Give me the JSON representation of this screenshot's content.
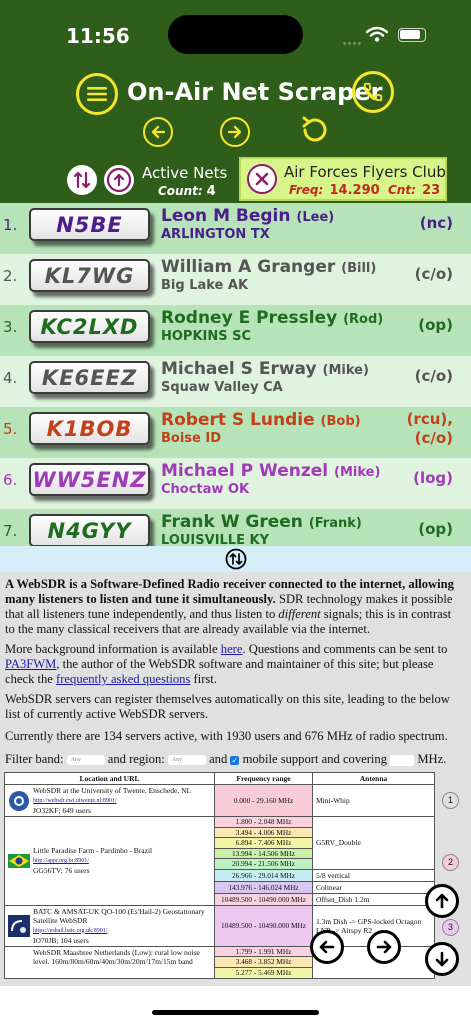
{
  "status": {
    "time": "11:56"
  },
  "header": {
    "title": "On-Air Net Scraper"
  },
  "active": {
    "label": "Active Nets",
    "count_label": "Count:",
    "count": "4"
  },
  "net": {
    "name": "Air Forces Flyers Club",
    "freq_label": "Freq:",
    "freq": "14.290",
    "cnt_label": "Cnt:",
    "cnt": "23"
  },
  "stations": [
    {
      "num": "1.",
      "call": "N5BE",
      "name": "Leon M Begin",
      "nick": "(Lee)",
      "loc": "ARLINGTON TX",
      "role": "(nc)",
      "color": "#4a1f8c",
      "bg": "#b7e3b8"
    },
    {
      "num": "2.",
      "call": "KL7WG",
      "name": "William A Granger",
      "nick": "(Bill)",
      "loc": "Big Lake AK",
      "role": "(c/o)",
      "color": "#555555",
      "bg": "#dff3df"
    },
    {
      "num": "3.",
      "call": "KC2LXD",
      "name": "Rodney E Pressley",
      "nick": "(Rod)",
      "loc": "HOPKINS SC",
      "role": "(op)",
      "color": "#1f6b1f",
      "bg": "#b7e3b8"
    },
    {
      "num": "4.",
      "call": "KE6EEZ",
      "name": "Michael S Erway",
      "nick": "(Mike)",
      "loc": "Squaw Valley CA",
      "role": "(c/o)",
      "color": "#555555",
      "bg": "#dff3df"
    },
    {
      "num": "5.",
      "call": "K1BOB",
      "name": "Robert S Lundie",
      "nick": "(Bob)",
      "loc": "Boise ID",
      "role": "(rcu),",
      "role2": "(c/o)",
      "color": "#c3401a",
      "bg": "#b7e3b8"
    },
    {
      "num": "6.",
      "call": "WW5ENZ",
      "name": "Michael P Wenzel",
      "nick": "(Mike)",
      "loc": "Choctaw OK",
      "role": "(log)",
      "color": "#a03bb8",
      "bg": "#dff3df"
    },
    {
      "num": "7.",
      "call": "N4GYY",
      "name": "Frank W Green",
      "nick": "(Frank)",
      "loc": "LOUISVILLE KY",
      "role": "(op)",
      "color": "#1f6b1f",
      "bg": "#b7e3b8"
    }
  ],
  "web": {
    "intro_bold": "A WebSDR is a Software-Defined Radio receiver connected to the internet, allowing many listeners to listen and tune it simultaneously.",
    "intro_rest1": " SDR technology makes it possible that all listeners tune independently, and thus listen to ",
    "intro_em": "different",
    "intro_rest2": " signals; this is in contrast to the many classical receivers that are already available via the internet.",
    "more_1": "More background information is available ",
    "more_here": "here",
    "more_2": ". Questions and comments can be sent to ",
    "more_pa3": "PA3FWM",
    "more_3": ", the author of the WebSDR software and maintainer of this site; but please check the ",
    "more_faq": "frequently asked questions",
    "more_4": " first.",
    "register": "WebSDR servers can register themselves automatically on this site, leading to the below list of currently active WebSDR servers.",
    "current": "Currently there are 134 servers active, with 1930 users and 676 MHz of radio spectrum.",
    "filter_1": "Filter band:",
    "filter_any": "Any",
    "filter_2": "and region:",
    "filter_3": "and",
    "filter_4": "mobile support and covering",
    "filter_5": "MHz.",
    "table_headers": [
      "Location and URL",
      "Frequency range",
      "Antenna"
    ],
    "servers": [
      {
        "name": "WebSDR at the University of Twente, Enschede, NL",
        "url": "http://websdr.ewi.utwente.nl:8901/",
        "meta": "JO32KF; 649 users",
        "freqs": [
          {
            "f": "0.000 - 29.160 MHz",
            "c": "#f7cbd8"
          }
        ],
        "antenna": [
          "Mini-Whip"
        ],
        "side": "1"
      },
      {
        "name": "Little Paradise Farm - Pardinho - Brazil",
        "url": "http://appr.org.br:8901/",
        "meta": "GG56TV; 76 users",
        "freqs": [
          {
            "f": "1.800 - 2.048 MHz",
            "c": "#f9d2e0"
          },
          {
            "f": "3.494 - 4.006 MHz",
            "c": "#fae7b4"
          },
          {
            "f": "6.894 - 7.406 MHz",
            "c": "#f3f5a6"
          },
          {
            "f": "13.994 - 14.506 MHz",
            "c": "#c8f0a6"
          },
          {
            "f": "20.994 - 21.506 MHz",
            "c": "#bdf3c3"
          },
          {
            "f": "26.966 - 29.014 MHz",
            "c": "#c6eef0"
          },
          {
            "f": "143.976 - 146.024 MHz",
            "c": "#d9c7f2"
          },
          {
            "f": "10489.500 - 10490.000 MHz",
            "c": "#f7d3e0"
          }
        ],
        "antenna": [
          "G5RV_Double",
          "5/8 vertical",
          "Colinear",
          "Offset_Dish 1.2m"
        ],
        "side": "2"
      },
      {
        "name": "BATC & AMSAT-UK QO-100 (Es'Hail-2) Geostationary Satellite WebSDR",
        "url": "https://eshail.batc.org.uk:8901/",
        "meta": "IO70JB; 104 users",
        "freqs": [
          {
            "f": "10489.500 - 10490.000 MHz",
            "c": "#ecc8f0"
          }
        ],
        "antenna": [
          "1.3m Dish -> GPS-locked Octagon",
          "LNB -> Airspy R2"
        ],
        "side": "3"
      },
      {
        "name": "WebSDR Maasbree Netherlands (Low): rural low noise level. 160m/80m/60m/40m/30m/20m/17m/15m band",
        "url": "",
        "meta": "",
        "freqs": [
          {
            "f": "1.799 - 1.991 MHz",
            "c": "#f9d2e0"
          },
          {
            "f": "3.468 - 3.852 MHz",
            "c": "#fae7b4"
          },
          {
            "f": "5.277 - 5.469 MHz",
            "c": "#f3f5a6"
          }
        ],
        "antenna": [
          ""
        ],
        "side": ""
      }
    ]
  }
}
